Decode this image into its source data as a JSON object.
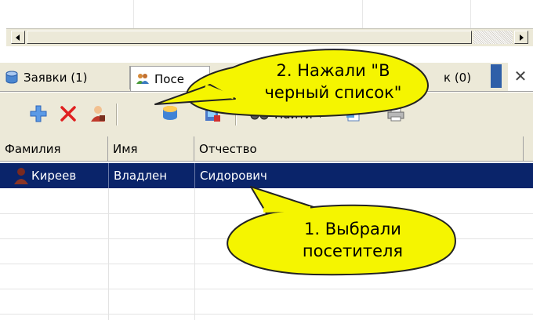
{
  "tabs": [
    {
      "label": "Заявки (1)",
      "icon": "database-icon"
    },
    {
      "label": "Посе",
      "icon": "users-icon"
    },
    {
      "label": "к (0)",
      "icon": ""
    }
  ],
  "tab_close": "✕",
  "toolbar": {
    "find_label": "Найти"
  },
  "grid": {
    "columns": [
      "Фамилия",
      "Имя",
      "Отчество"
    ],
    "rows": [
      {
        "surname": "Киреев",
        "name": "Владлен",
        "patronymic": "Сидорович",
        "selected": true
      }
    ]
  },
  "callouts": {
    "step2_line1": "2. Нажали \"В",
    "step2_line2": "черный список\"",
    "step1_line1": "1. Выбрали",
    "step1_line2": "посетителя"
  },
  "colors": {
    "selection": "#0a246a",
    "callout_fill": "#f5f500",
    "window_bg": "#ece9d8"
  }
}
